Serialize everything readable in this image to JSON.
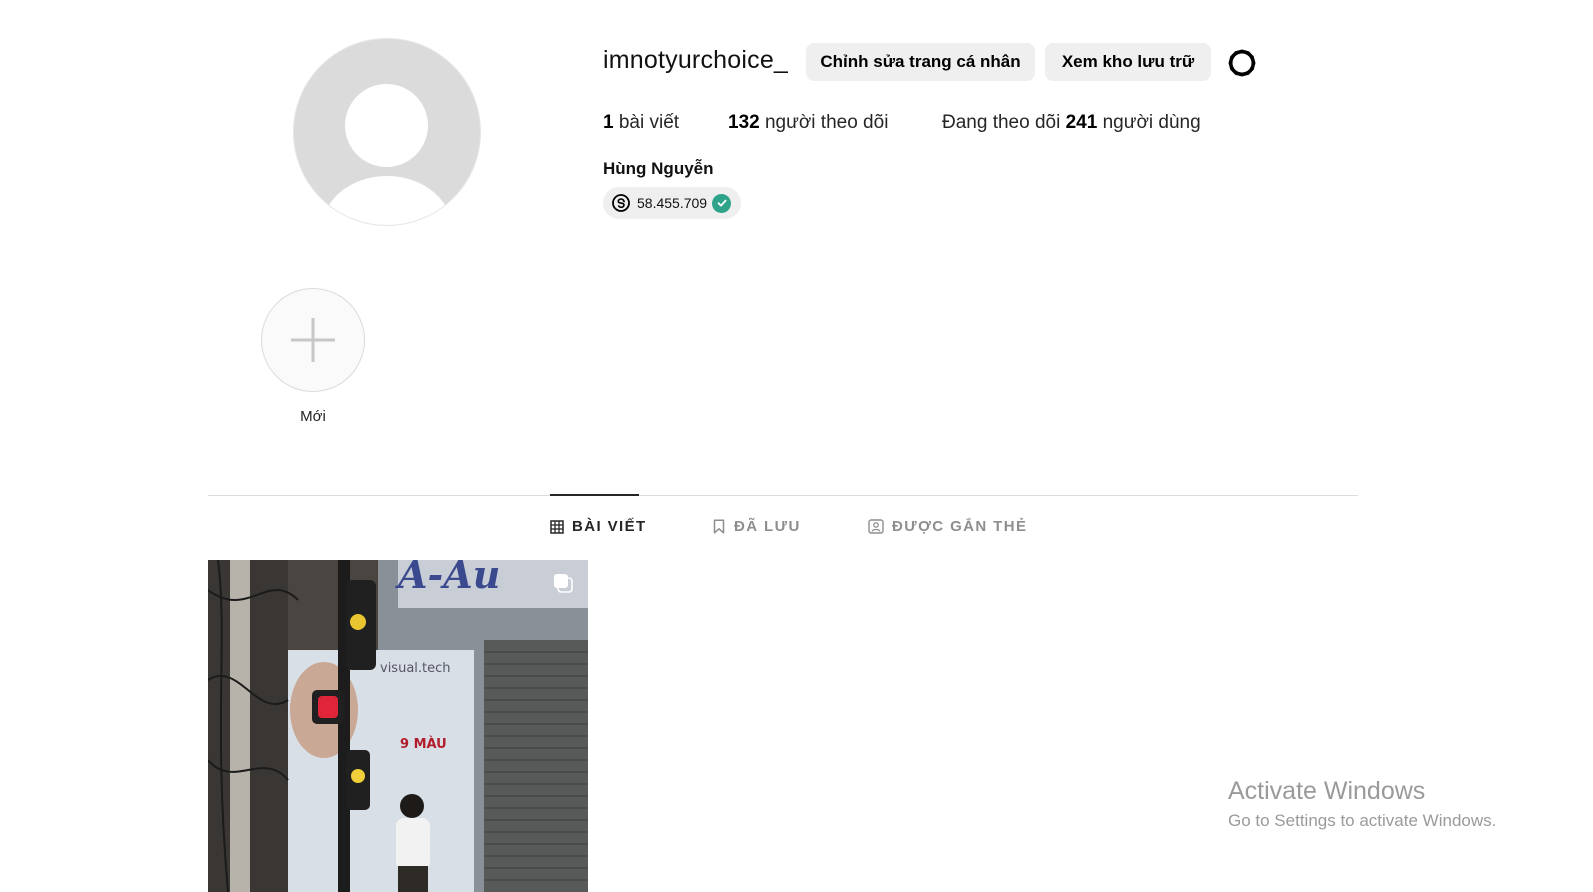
{
  "profile": {
    "username": "imnotyurchoice_",
    "full_name": "Hùng Nguyễn",
    "threads_count": "58.455.709",
    "edit_button_label": "Chỉnh sửa trang cá nhân",
    "archive_button_label": "Xem kho lưu trữ"
  },
  "stats": {
    "posts_value": "1",
    "posts_label": "bài viết",
    "followers_value": "132",
    "followers_label": "người theo dõi",
    "following_prefix": "Đang theo dõi",
    "following_value": "241",
    "following_label": "người dùng"
  },
  "highlights": {
    "new_label": "Mới"
  },
  "tabs": [
    {
      "label": "BÀI VIẾT",
      "active": true,
      "icon": "grid-icon"
    },
    {
      "label": "ĐÃ LƯU",
      "active": false,
      "icon": "bookmark-icon"
    },
    {
      "label": "ĐƯỢC GẮN THẺ",
      "active": false,
      "icon": "tagged-icon"
    }
  ],
  "posts": [
    {
      "type": "carousel",
      "icon": "multiple-images-icon",
      "sign_text": "visual.tech",
      "poster_text": "9 MÀU"
    }
  ],
  "watermark": {
    "title": "Activate Windows",
    "subtitle": "Go to Settings to activate Windows."
  },
  "colors": {
    "button_bg": "#efefef",
    "verified_green": "#2fa38a",
    "divider": "#dbdbdb",
    "inactive_tab": "#8e8e8e"
  }
}
